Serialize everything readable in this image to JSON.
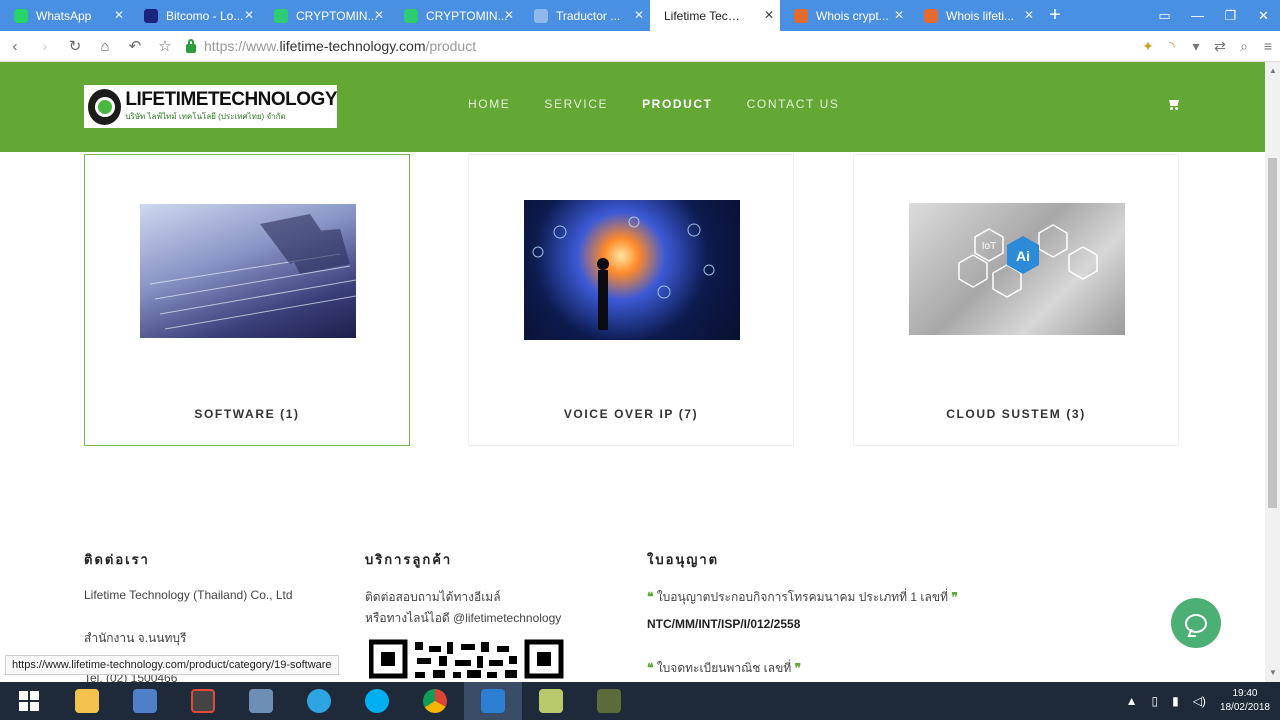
{
  "browser": {
    "tabs": [
      {
        "label": "WhatsApp",
        "icon": "whatsapp-icon",
        "color": "#25d366"
      },
      {
        "label": "Bitcomo - Lo...",
        "icon": "hashtag-icon",
        "color": "#1a237e"
      },
      {
        "label": "CRYPTOMIN...",
        "icon": "crypto-icon",
        "color": "#2ecc71"
      },
      {
        "label": "CRYPTOMIN...",
        "icon": "crypto-icon",
        "color": "#2ecc71"
      },
      {
        "label": "Traductor ...",
        "icon": "translate-icon",
        "color": "#8fb8ec"
      },
      {
        "label": "Lifetime Techno...",
        "icon": "page-icon",
        "color": "#ffffff",
        "active": true
      },
      {
        "label": "Whois crypt...",
        "icon": "whois-icon",
        "color": "#e46b2e"
      },
      {
        "label": "Whois lifeti...",
        "icon": "whois-icon",
        "color": "#e46b2e"
      }
    ],
    "url_prefix": "https://www.",
    "url_host": "lifetime-technology.com",
    "url_path": "/product",
    "status_url": "https://www.lifetime-technology.com/product/category/19-software"
  },
  "site": {
    "logo_text": "LIFETIMETECHNOLOGY",
    "logo_subtext": "บริษัท ไลฟ์ไทม์ เทคโนโลยี (ประเทศไทย) จำกัด",
    "nav": [
      "HOME",
      "SERVICE",
      "PRODUCT",
      "CONTACT US"
    ],
    "active_nav": "PRODUCT",
    "accent_color": "#63a735"
  },
  "products": [
    {
      "title": "SOFTWARE (1)",
      "image": "robot-keyboard-image",
      "selected": true
    },
    {
      "title": "VOICE OVER IP (7)",
      "image": "city-network-image",
      "selected": false
    },
    {
      "title": "CLOUD SUSTEM (3)",
      "image": "ai-iot-hexagon-image",
      "selected": false
    }
  ],
  "footer": {
    "contact": {
      "title": "ติดต่อเรา",
      "company": "Lifetime Technology (Thailand) Co., Ltd",
      "office": "สำนักงาน จ.นนทบุรี",
      "tel": "Tel. (02) 1500466"
    },
    "service": {
      "title": "บริการลูกค้า",
      "line1": "ติดต่อสอบถามได้ทางอีเมล์",
      "line2": "หรือทางไลน์ไอดี @lifetimetechnology"
    },
    "license": {
      "title": "ใบอนุญาต",
      "item1": "ใบอนุญาตประกอบกิจการโทรคมนาคม ประเภทที่ 1 เลขที่",
      "item1_no": "NTC/MM/INT/ISP/I/012/2558",
      "item2": "ใบจดทะเบียนพาณิช เลขที่"
    }
  },
  "taskbar": {
    "time": "19:40",
    "date": "18/02/2018"
  }
}
